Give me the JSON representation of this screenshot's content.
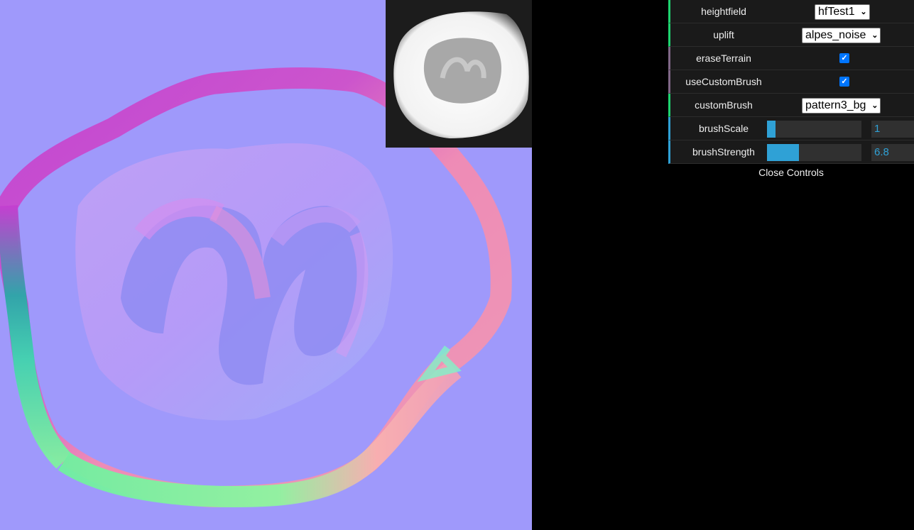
{
  "viewport": {
    "background_color": "#9f99fb",
    "content": "normal-map render of heightfield terrain"
  },
  "preview": {
    "content": "grayscale heightmap thumbnail"
  },
  "controls": {
    "heightfield": {
      "label": "heightfield",
      "value": "hfTest1"
    },
    "uplift": {
      "label": "uplift",
      "value": "alpes_noise"
    },
    "eraseTerrain": {
      "label": "eraseTerrain",
      "checked": true
    },
    "useCustomBrush": {
      "label": "useCustomBrush",
      "checked": true
    },
    "customBrush": {
      "label": "customBrush",
      "value": "pattern3_bg"
    },
    "brushScale": {
      "label": "brushScale",
      "value": "1",
      "fraction": 0.09
    },
    "brushStrength": {
      "label": "brushStrength",
      "value": "6.8",
      "fraction": 0.34
    },
    "close_label": "Close Controls"
  },
  "colors": {
    "string_accent": "#1ed36f",
    "boolean_accent": "#806787",
    "number_accent": "#2fa1d6",
    "checkbox": "#0075ff"
  },
  "icons": {
    "dropdown": "chevron-down-icon",
    "checkbox": "checkmark-icon"
  }
}
